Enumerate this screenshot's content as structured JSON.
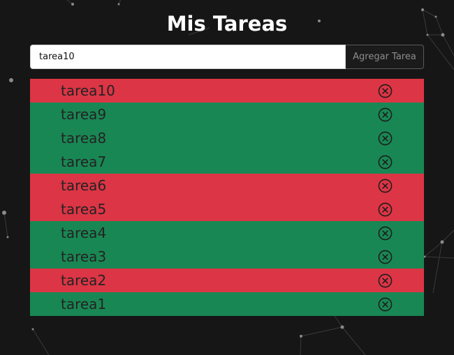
{
  "header": {
    "title": "Mis Tareas"
  },
  "form": {
    "input_value": "tarea10",
    "button_label": "Agregar Tarea"
  },
  "tasks": [
    {
      "label": "tarea10",
      "status": "pending",
      "delete_icon": "circle-x-icon"
    },
    {
      "label": "tarea9",
      "status": "done",
      "delete_icon": "circle-x-icon"
    },
    {
      "label": "tarea8",
      "status": "done",
      "delete_icon": "circle-x-icon"
    },
    {
      "label": "tarea7",
      "status": "done",
      "delete_icon": "circle-x-icon"
    },
    {
      "label": "tarea6",
      "status": "pending",
      "delete_icon": "circle-x-icon"
    },
    {
      "label": "tarea5",
      "status": "pending",
      "delete_icon": "circle-x-icon"
    },
    {
      "label": "tarea4",
      "status": "done",
      "delete_icon": "circle-x-icon"
    },
    {
      "label": "tarea3",
      "status": "done",
      "delete_icon": "circle-x-icon"
    },
    {
      "label": "tarea2",
      "status": "pending",
      "delete_icon": "circle-x-icon"
    },
    {
      "label": "tarea1",
      "status": "done",
      "delete_icon": "circle-x-icon"
    }
  ],
  "colors": {
    "background": "#161616",
    "pending": "#dc3545",
    "done": "#198754"
  }
}
